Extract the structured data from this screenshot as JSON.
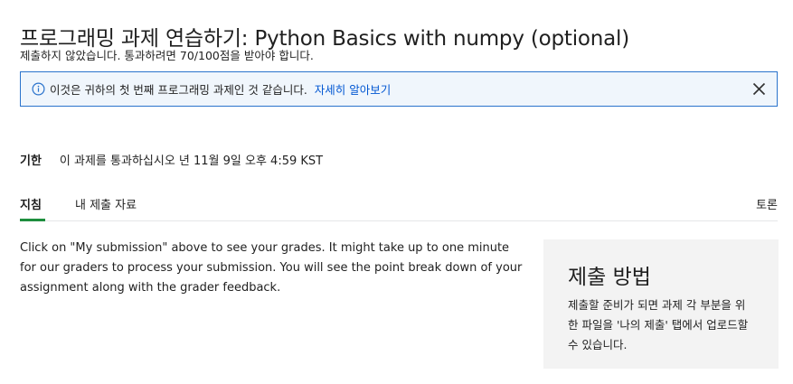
{
  "header": {
    "title": "프로그래밍 과제 연습하기: Python Basics with numpy (optional)",
    "status": "제출하지 않았습니다. 통과하려면 70/100점을 받아야 합니다."
  },
  "banner": {
    "icon": "info-icon",
    "message": "이것은 귀하의 첫 번째 프로그래밍 과제인 것 같습니다.",
    "link_label": "자세히 알아보기",
    "close_icon": "close-icon",
    "border_color": "#2a73cc",
    "link_color": "#0056d2"
  },
  "deadline": {
    "label": "기한",
    "value": "이 과제를 통과하십시오 년 11월 9일 오후 4:59 KST"
  },
  "tabs": {
    "items": [
      {
        "label": "지침",
        "active": true
      },
      {
        "label": "내 제출 자료",
        "active": false
      }
    ],
    "right_label": "토론",
    "active_color": "#1e8e3e"
  },
  "main": {
    "instructions": "Click on \"My submission\" above to see your grades. It might take up to one minute for our graders to process your submission. You will see the point break down of your assignment along with the grader feedback."
  },
  "how_to_submit": {
    "title": "제출 방법",
    "description": "제출할 준비가 되면 과제 각 부분을 위한 파일을 '나의 제출' 탭에서 업로드할 수 있습니다."
  }
}
